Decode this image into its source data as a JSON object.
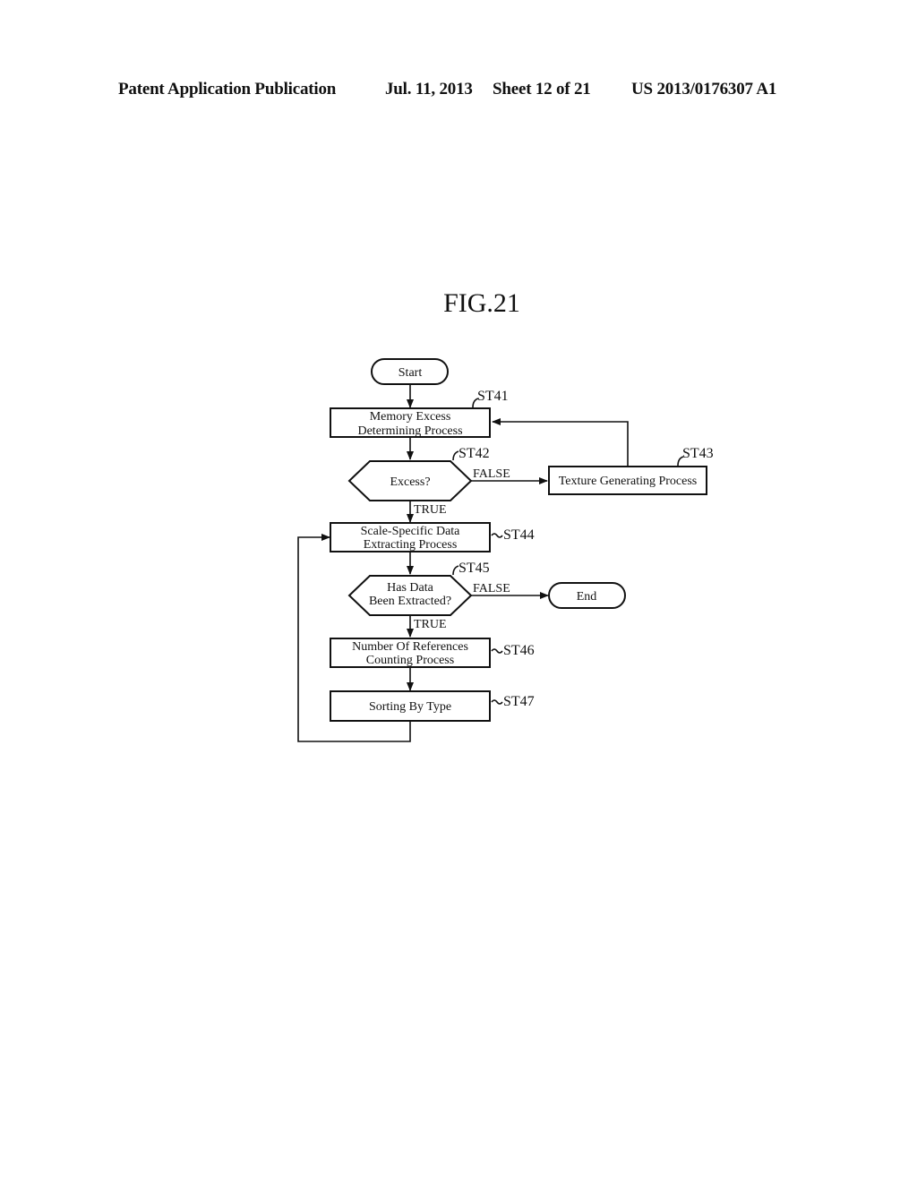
{
  "header": {
    "publication": "Patent Application Publication",
    "date": "Jul. 11, 2013",
    "sheet": "Sheet 12 of 21",
    "number": "US 2013/0176307 A1"
  },
  "figure": {
    "title": "FIG.21",
    "nodes": {
      "start": {
        "type": "terminal",
        "label": "Start"
      },
      "st41": {
        "type": "process",
        "step": "ST41",
        "lines": [
          "Memory Excess",
          "Determining Process"
        ]
      },
      "st42": {
        "type": "decision",
        "step": "ST42",
        "lines": [
          "Excess?"
        ]
      },
      "st43": {
        "type": "process",
        "step": "ST43",
        "lines": [
          "Texture Generating Process"
        ]
      },
      "st44": {
        "type": "process",
        "step": "ST44",
        "lines": [
          "Scale-Specific Data",
          "Extracting Process"
        ]
      },
      "st45": {
        "type": "decision",
        "step": "ST45",
        "lines": [
          "Has Data",
          "Been Extracted?"
        ]
      },
      "end": {
        "type": "terminal",
        "label": "End"
      },
      "st46": {
        "type": "process",
        "step": "ST46",
        "lines": [
          "Number Of References",
          "Counting Process"
        ]
      },
      "st47": {
        "type": "process",
        "step": "ST47",
        "lines": [
          "Sorting By Type"
        ]
      }
    },
    "edge_labels": {
      "st42_false": "FALSE",
      "st42_true": "TRUE",
      "st45_false": "FALSE",
      "st45_true": "TRUE"
    },
    "edges": [
      {
        "from": "start",
        "to": "st41"
      },
      {
        "from": "st41",
        "to": "st42"
      },
      {
        "from": "st42",
        "to": "st43",
        "label": "FALSE"
      },
      {
        "from": "st43",
        "to": "st41"
      },
      {
        "from": "st42",
        "to": "st44",
        "label": "TRUE"
      },
      {
        "from": "st44",
        "to": "st45"
      },
      {
        "from": "st45",
        "to": "end",
        "label": "FALSE"
      },
      {
        "from": "st45",
        "to": "st46",
        "label": "TRUE"
      },
      {
        "from": "st46",
        "to": "st47"
      },
      {
        "from": "st47",
        "to": "st44"
      }
    ]
  }
}
